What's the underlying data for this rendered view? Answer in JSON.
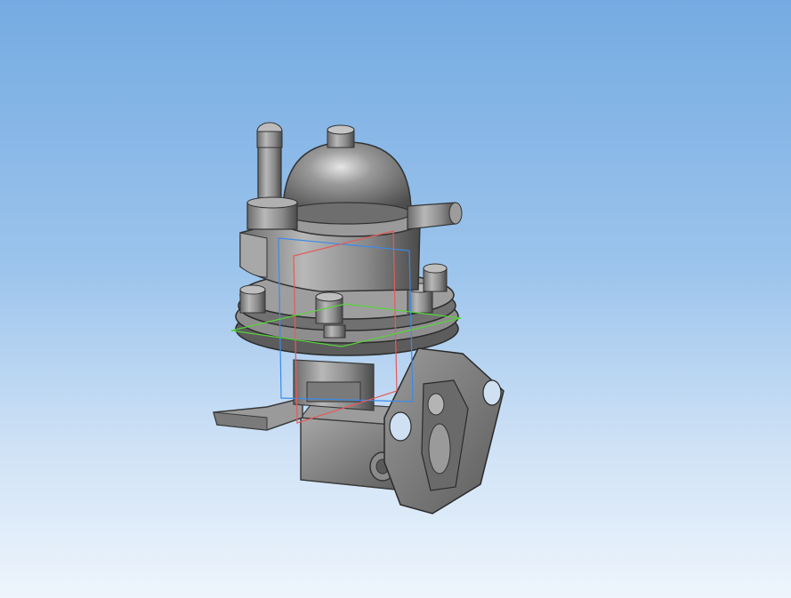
{
  "scene": {
    "background_top": "#75abe2",
    "background_bottom": "#eef5fc",
    "part_color": "#8c8c8c",
    "part_dark": "#5e5e5e",
    "part_light": "#c8c8c8",
    "plane_colors": {
      "front_plane": "#3c8be6",
      "right_plane": "#e65a5a",
      "top_plane": "#58d23c"
    },
    "model_icon": "fuel-pump-3d-model"
  }
}
